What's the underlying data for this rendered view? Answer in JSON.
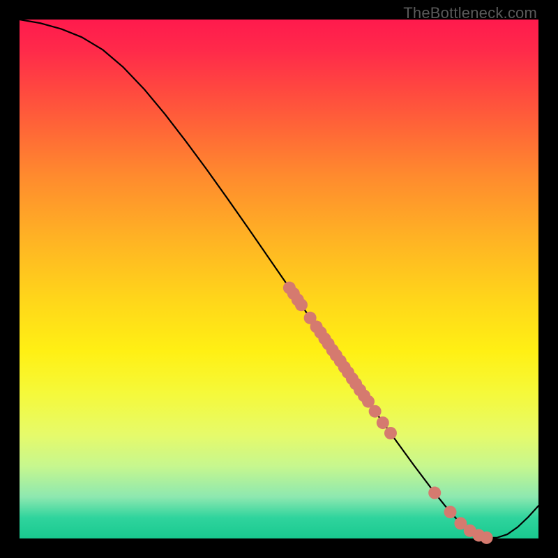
{
  "watermark": "TheBottleneck.com",
  "colors": {
    "dot": "#d57a6f",
    "curve": "#000000"
  },
  "chart_data": {
    "type": "line",
    "title": "",
    "xlabel": "",
    "ylabel": "",
    "xlim": [
      0,
      100
    ],
    "ylim": [
      0,
      100
    ],
    "grid": false,
    "legend": false,
    "series": [
      {
        "name": "curve",
        "x": [
          0,
          4,
          8,
          12,
          16,
          20,
          24,
          28,
          32,
          36,
          40,
          44,
          48,
          52,
          56,
          60,
          64,
          68,
          72,
          76,
          80,
          82,
          84,
          86,
          88,
          90,
          92,
          94,
          96,
          98,
          100
        ],
        "y": [
          100,
          99.3,
          98.2,
          96.6,
          94.2,
          90.8,
          86.6,
          81.8,
          76.6,
          71.2,
          65.6,
          59.9,
          54.1,
          48.3,
          42.5,
          36.7,
          30.9,
          25.2,
          19.6,
          14.1,
          8.8,
          6.3,
          4.0,
          2.1,
          0.8,
          0.15,
          0.15,
          0.8,
          2.2,
          4.1,
          6.3
        ]
      }
    ],
    "points": [
      {
        "x": 52.0,
        "y": 48.3
      },
      {
        "x": 52.8,
        "y": 47.2
      },
      {
        "x": 53.6,
        "y": 46.0
      },
      {
        "x": 54.3,
        "y": 45.0
      },
      {
        "x": 56.0,
        "y": 42.5
      },
      {
        "x": 57.2,
        "y": 40.8
      },
      {
        "x": 58.0,
        "y": 39.7
      },
      {
        "x": 58.8,
        "y": 38.5
      },
      {
        "x": 59.5,
        "y": 37.5
      },
      {
        "x": 60.3,
        "y": 36.3
      },
      {
        "x": 61.0,
        "y": 35.3
      },
      {
        "x": 61.8,
        "y": 34.2
      },
      {
        "x": 62.6,
        "y": 33.0
      },
      {
        "x": 63.3,
        "y": 32.0
      },
      {
        "x": 64.1,
        "y": 30.8
      },
      {
        "x": 64.8,
        "y": 29.8
      },
      {
        "x": 65.6,
        "y": 28.6
      },
      {
        "x": 66.4,
        "y": 27.5
      },
      {
        "x": 67.2,
        "y": 26.4
      },
      {
        "x": 68.5,
        "y": 24.5
      },
      {
        "x": 70.0,
        "y": 22.3
      },
      {
        "x": 71.5,
        "y": 20.3
      },
      {
        "x": 80.0,
        "y": 8.8
      },
      {
        "x": 83.0,
        "y": 5.1
      },
      {
        "x": 85.0,
        "y": 2.9
      },
      {
        "x": 86.8,
        "y": 1.5
      },
      {
        "x": 88.5,
        "y": 0.6
      },
      {
        "x": 90.0,
        "y": 0.15
      }
    ]
  }
}
